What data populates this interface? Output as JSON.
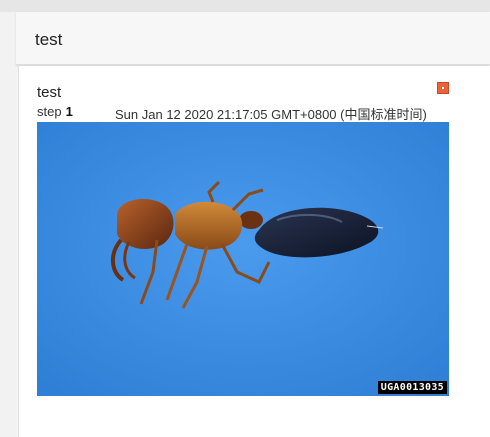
{
  "header": {
    "title": "test"
  },
  "card": {
    "title": "test",
    "step_word": "step",
    "step_number": "1",
    "timestamp": "Sun Jan 12 2020 21:17:05 GMT+0800 (中国标准时间)",
    "image": {
      "watermark": "UGA0013035",
      "background_color": "#3f8fe2"
    },
    "pin_icon": "pin-icon",
    "pin_color": "#e8643a"
  }
}
